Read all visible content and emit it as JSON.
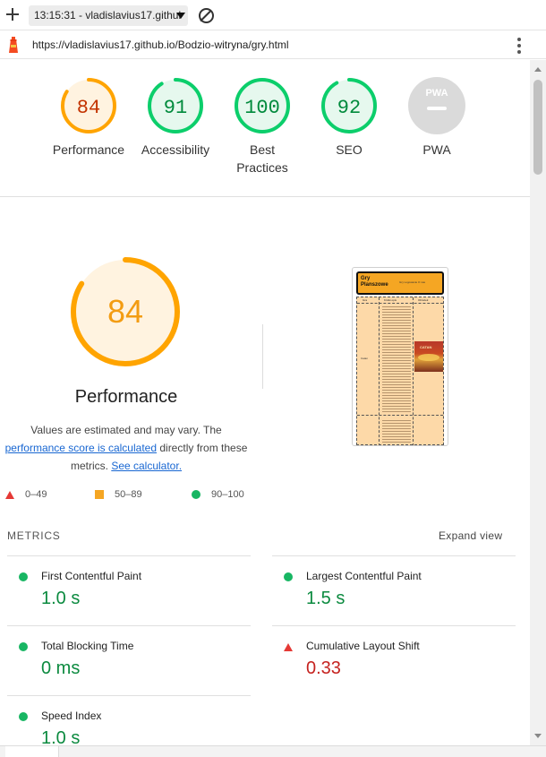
{
  "toolbar": {
    "report_label": "13:15:31 - vladislavius17.githul"
  },
  "urlbar": {
    "url": "https://vladislavius17.github.io/Bodzio-witryna/gry.html"
  },
  "gauges": [
    {
      "score": "84",
      "label": "Performance",
      "status": "average"
    },
    {
      "score": "91",
      "label": "Accessibility",
      "status": "pass"
    },
    {
      "score": "100",
      "label": "Best Practices",
      "status": "pass"
    },
    {
      "score": "92",
      "label": "SEO",
      "status": "pass"
    },
    {
      "score": "",
      "label": "PWA",
      "status": "na",
      "badge": "PWA"
    }
  ],
  "performance": {
    "score": "84",
    "score_fraction": 0.84,
    "title": "Performance",
    "desc_1": "Values are estimated and may vary. The",
    "desc_link": "performance score is calculated",
    "desc_2": " directly from these metrics.",
    "calc_link": "See calculator."
  },
  "legend": {
    "fail": "0–49",
    "average": "50–89",
    "pass": "90–100"
  },
  "thumbnail": {
    "site_title": "Gry Planszowe",
    "nav": "Gry   Logowanie   O nas",
    "col_1": "Gra",
    "col_2": "Krótki opis",
    "col_3": "Obrazek",
    "row_label": "Catan",
    "image_label": "CATAN"
  },
  "metrics": {
    "heading": "METRICS",
    "expand_label": "Expand view",
    "items": [
      {
        "name": "First Contentful Paint",
        "value": "1.0 s",
        "status": "pass"
      },
      {
        "name": "Largest Contentful Paint",
        "value": "1.5 s",
        "status": "pass"
      },
      {
        "name": "Total Blocking Time",
        "value": "0 ms",
        "status": "pass"
      },
      {
        "name": "Cumulative Layout Shift",
        "value": "0.33",
        "status": "fail"
      },
      {
        "name": "Speed Index",
        "value": "1.0 s",
        "status": "pass"
      }
    ]
  },
  "colors": {
    "pass": "#0cce6b",
    "average": "#ffa400",
    "fail": "#ff4e42",
    "na": "#dadada"
  }
}
